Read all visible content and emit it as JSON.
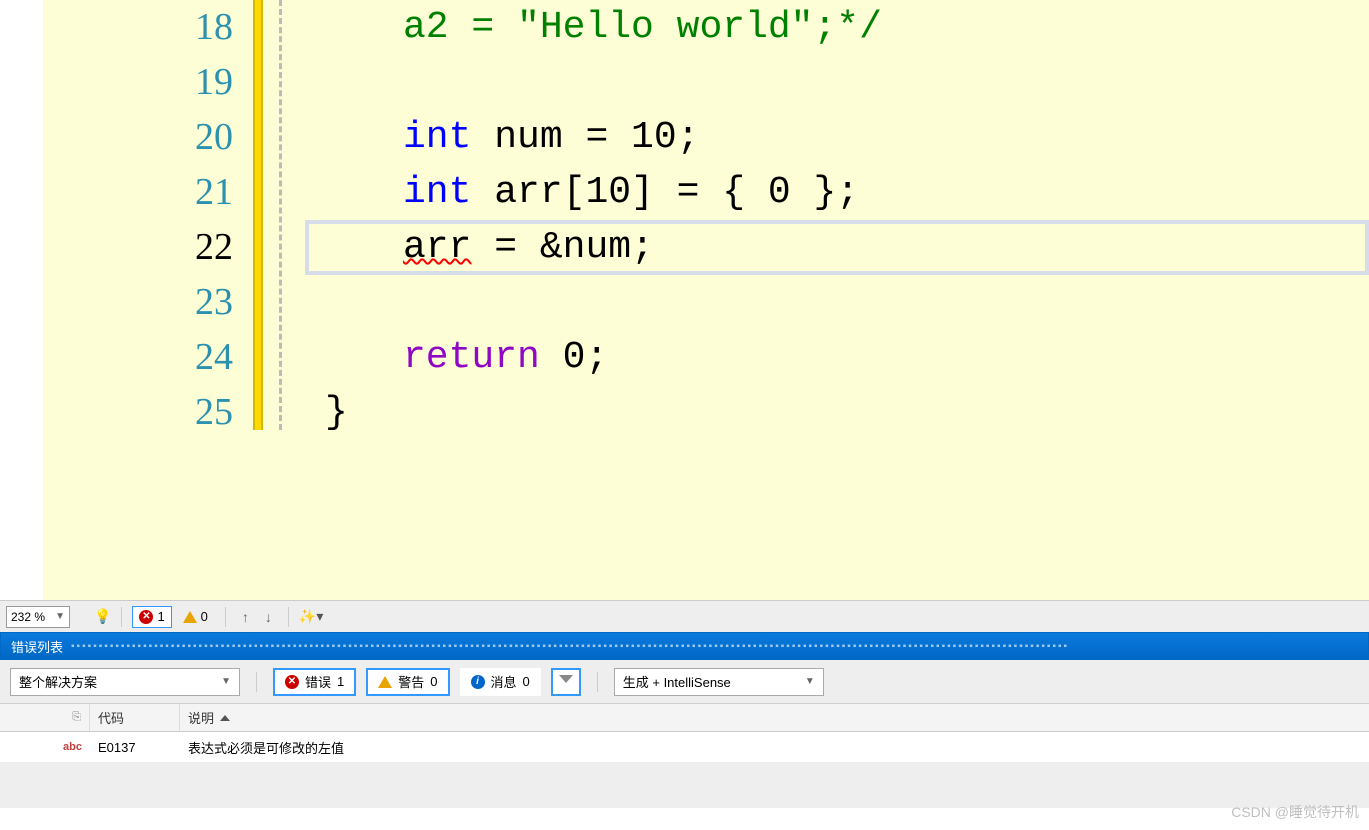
{
  "editor": {
    "line_numbers": [
      "18",
      "19",
      "20",
      "21",
      "22",
      "23",
      "24",
      "25"
    ],
    "current_line_index": 4,
    "lines": {
      "l18": {
        "pre": "a2 = ",
        "str": "\"Hello world\"",
        "post": ";*/"
      },
      "l20": {
        "type": "int",
        "rest": " num = 10;"
      },
      "l21": {
        "type": "int",
        "rest": " arr[10] = { 0 };"
      },
      "l22": {
        "err": "arr",
        "rest": " = &num;"
      },
      "l24": {
        "kw": "return",
        "rest": " 0;"
      },
      "l25": "}"
    }
  },
  "toolbar": {
    "zoom": "232 %",
    "errors": "1",
    "warnings": "0"
  },
  "panel": {
    "title": "错误列表",
    "scope": "整个解决方案",
    "filters": {
      "errors_label": "错误",
      "errors_count": "1",
      "warnings_label": "警告",
      "warnings_count": "0",
      "messages_label": "消息",
      "messages_count": "0"
    },
    "source_combo": "生成 + IntelliSense",
    "columns": {
      "code": "代码",
      "desc": "说明"
    },
    "row": {
      "icon": "abc",
      "code": "E0137",
      "desc": "表达式必须是可修改的左值"
    }
  },
  "watermark": "CSDN @睡觉待开机"
}
